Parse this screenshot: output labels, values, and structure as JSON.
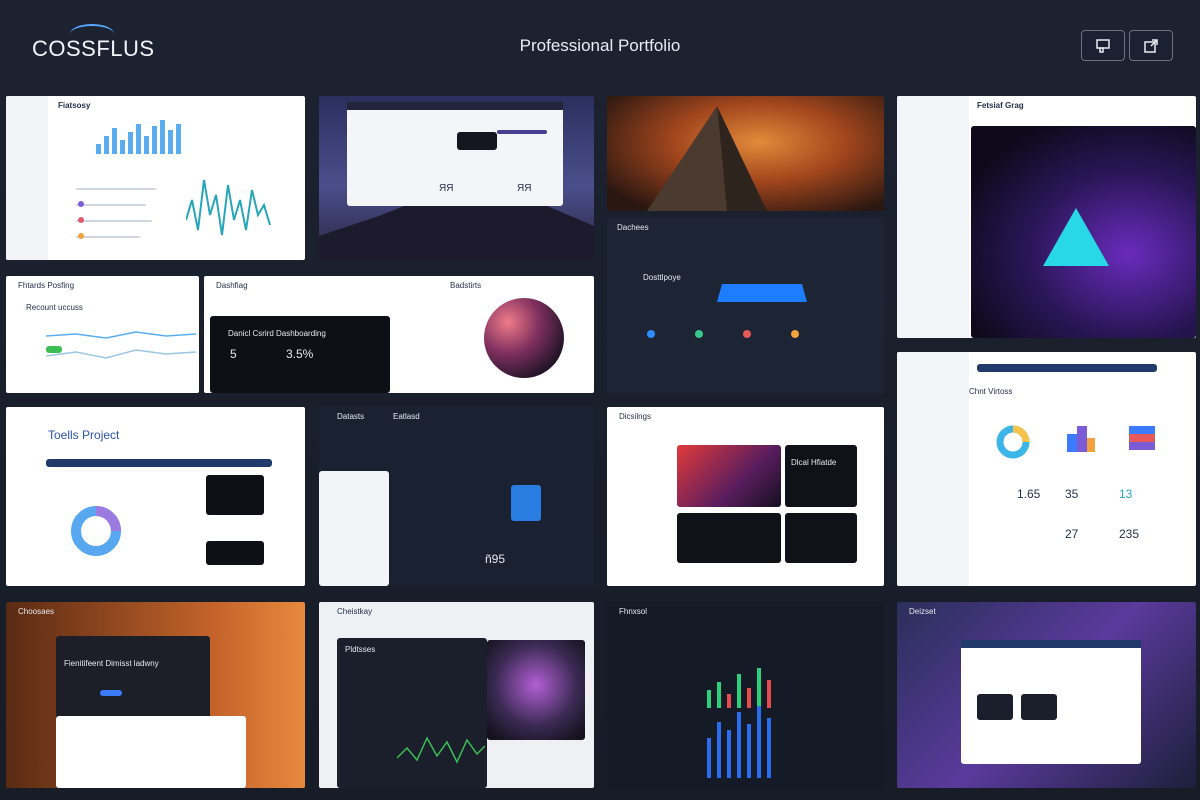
{
  "header": {
    "logo": "COSSFLUS",
    "title": "Professional Portfolio"
  },
  "icons": {
    "layout": "layout-icon",
    "export": "export-icon"
  },
  "tiles": {
    "t1": {
      "label": "Fiatsosy"
    },
    "t5": {
      "label": "Fhtards Posfing",
      "sub": "Recount uccuss"
    },
    "t6": {
      "label": "Dashfiag",
      "panel": "Danicl Csrird Dashboarding",
      "v1": "5",
      "v2": "3.5%",
      "side": "Badstirts"
    },
    "t7": {
      "label": "Dachees",
      "sub": "Dosttlpoye"
    },
    "t8": {
      "label": "Chnt Virtoss"
    },
    "t9": {
      "label": "Toells Project"
    },
    "t10": {
      "label": "Datasts",
      "sub": "Eatlasd",
      "n": "ñ95"
    },
    "t11": {
      "label": "Dicsilngs",
      "sub": "Dlcal Hfiatde"
    },
    "t12": {
      "v1": "1.65",
      "v2": "35",
      "v3": "13",
      "v4": "27",
      "v5": "235"
    },
    "t13": {
      "label": "Choosaes",
      "panel": "Fienitifeent Dimisst ladwny"
    },
    "t14": {
      "label": "Cheistkay",
      "sub": "Pldtsses"
    },
    "t15": {
      "label": "Fhnxsol"
    },
    "t16": {
      "label": "Deizset"
    }
  }
}
